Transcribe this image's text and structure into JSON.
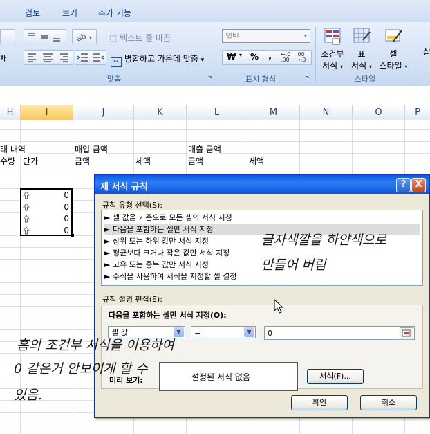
{
  "ribbon": {
    "tabs": [
      "검토",
      "보기",
      "추가 기능"
    ],
    "wrap_text": "텍스트 줄 바꿈",
    "merge_center": "병합하고 가운데 맞춤",
    "number_format": "일반",
    "currency": "₩",
    "percent": "%",
    "comma": ",",
    "conditional": [
      "조건부",
      "서식"
    ],
    "table": [
      "표",
      "서식"
    ],
    "cell_style": [
      "셀",
      "스타일"
    ],
    "groups": {
      "alignment": "맞춤",
      "number": "표시 형식",
      "style": "스타일"
    },
    "partial_left": "채",
    "partial_right": "삽"
  },
  "sheet": {
    "columns": [
      "H",
      "I",
      "J",
      "K",
      "L",
      "M",
      "N",
      "O",
      "P"
    ],
    "row1": {
      "h": "래 내역",
      "j": "매입 금액",
      "l": "매출 금액"
    },
    "row2": {
      "h": "수량",
      "i": "단가",
      "j": "금액",
      "k": "세액",
      "l": "금액",
      "m": "세액"
    },
    "values": [
      "0",
      "0",
      "0",
      "0"
    ]
  },
  "dialog": {
    "title": "새 서식 규칙",
    "help": "?",
    "close": "X",
    "rule_type_label": "규칙 유형 선택(S):",
    "rule_types": [
      "► 셀 값을 기준으로 모든 셀의 서식 지정",
      "► 다음을 포함하는 셀만 서식 지정",
      "► 상위 또는 하위 값만 서식 지정",
      "► 평균보다 크거나 작은 값만 서식 지정",
      "► 고유 또는 중복 값만 서식 지정",
      "► 수식을 사용하여 서식을 지정할 셀 결정"
    ],
    "edit_label": "규칙 설명 편집(E):",
    "format_only_label": "다음을 포함하는 셀만 서식 지정(O):",
    "combo1": "셀 값",
    "combo2": "=",
    "value_input": "0",
    "preview_label": "미리 보기:",
    "preview_text": "설정된 서식 없음",
    "format_button": "서식(F)...",
    "ok": "확인",
    "cancel": "취소"
  },
  "annotations": {
    "note1": [
      "글자색깔을 하얀색으로",
      "만들어 버림"
    ],
    "note2": [
      "홈의 조건부 서식을 이용하여",
      "0 같은거 안보이게 할 수",
      "있음."
    ]
  }
}
